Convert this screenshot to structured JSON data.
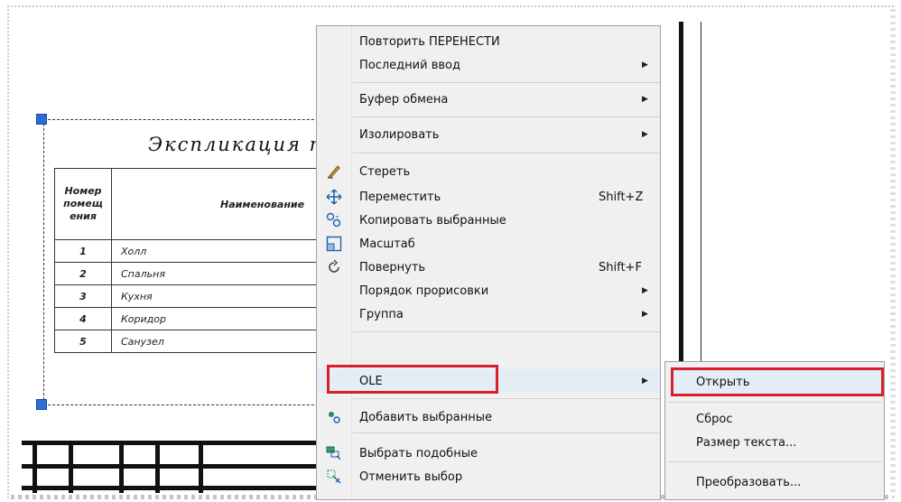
{
  "drawing": {
    "title": "Экспликация по",
    "table": {
      "header_number": "Номер помещ ения",
      "header_name": "Наименование",
      "rows": [
        {
          "num": "1",
          "name": "Холл"
        },
        {
          "num": "2",
          "name": "Спальня"
        },
        {
          "num": "3",
          "name": "Кухня"
        },
        {
          "num": "4",
          "name": "Коридор"
        },
        {
          "num": "5",
          "name": "Санузел"
        }
      ]
    }
  },
  "context_menu": {
    "items": [
      {
        "label": "Повторить ПЕРЕНЕСТИ",
        "shortcut": "",
        "submenu": false,
        "icon": ""
      },
      {
        "label": "Последний ввод",
        "shortcut": "",
        "submenu": true,
        "icon": ""
      },
      {
        "label": "Буфер обмена",
        "shortcut": "",
        "submenu": true,
        "icon": ""
      },
      {
        "label": "Изолировать",
        "shortcut": "",
        "submenu": true,
        "icon": ""
      },
      {
        "label": "Стереть",
        "shortcut": "",
        "submenu": false,
        "icon": "eraser-icon"
      },
      {
        "label": "Переместить",
        "shortcut": "Shift+Z",
        "submenu": false,
        "icon": "move-icon"
      },
      {
        "label": "Копировать выбранные",
        "shortcut": "",
        "submenu": false,
        "icon": "copy-icon"
      },
      {
        "label": "Масштаб",
        "shortcut": "",
        "submenu": false,
        "icon": "scale-icon"
      },
      {
        "label": "Повернуть",
        "shortcut": "Shift+F",
        "submenu": false,
        "icon": "rotate-icon"
      },
      {
        "label": "Порядок прорисовки",
        "shortcut": "",
        "submenu": true,
        "icon": ""
      },
      {
        "label": "Группа",
        "shortcut": "",
        "submenu": true,
        "icon": ""
      },
      {
        "label": "OLE",
        "shortcut": "",
        "submenu": true,
        "icon": ""
      },
      {
        "label": "Добавить выбранные",
        "shortcut": "",
        "submenu": false,
        "icon": "add-selected-icon"
      },
      {
        "label": "Выбрать подобные",
        "shortcut": "",
        "submenu": false,
        "icon": "select-similar-icon"
      },
      {
        "label": "Отменить выбор",
        "shortcut": "",
        "submenu": false,
        "icon": "deselect-icon"
      }
    ]
  },
  "ole_submenu": {
    "items": [
      {
        "label": "Открыть"
      },
      {
        "label": "Сброс"
      },
      {
        "label": "Размер текста..."
      },
      {
        "label": "Преобразовать..."
      }
    ]
  },
  "colors": {
    "highlight_border": "#d8202a",
    "grip": "#2b6fd6",
    "menu_bg": "#f0f0f0"
  }
}
